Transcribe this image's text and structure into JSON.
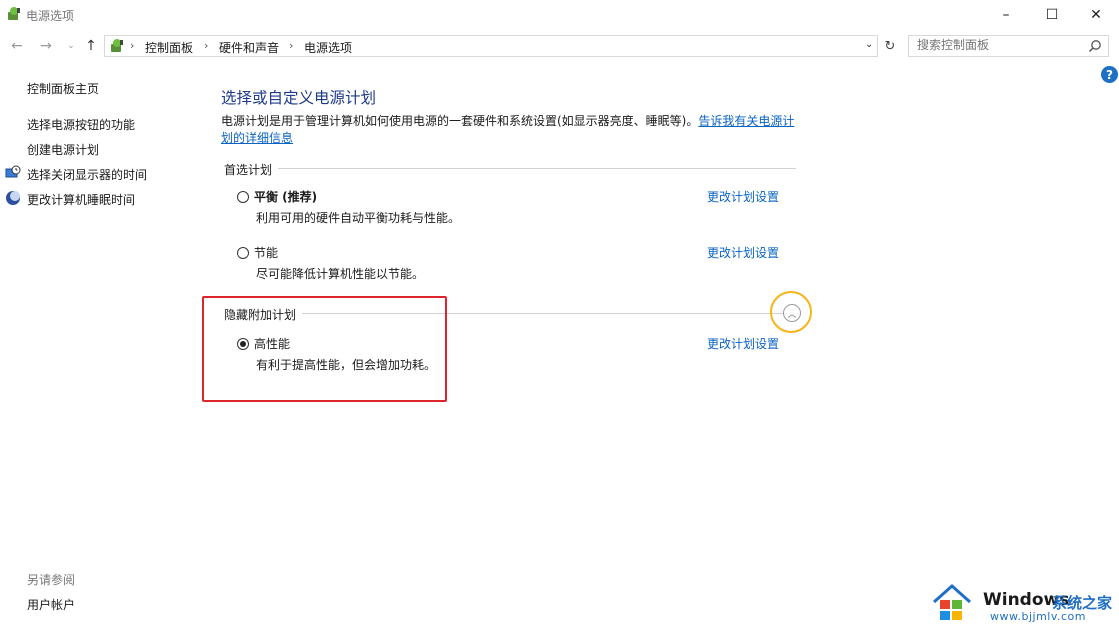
{
  "window": {
    "title": "电源选项"
  },
  "address": {
    "crumbs": [
      "控制面板",
      "硬件和声音",
      "电源选项"
    ]
  },
  "search": {
    "placeholder": "搜索控制面板"
  },
  "sidebar": {
    "home": "控制面板主页",
    "items": [
      {
        "label": "选择电源按钮的功能",
        "icon": ""
      },
      {
        "label": "创建电源计划",
        "icon": ""
      },
      {
        "label": "选择关闭显示器的时间",
        "icon": "monitor-clock-icon"
      },
      {
        "label": "更改计算机睡眠时间",
        "icon": "moon-globe-icon"
      }
    ],
    "see_also_title": "另请参阅",
    "see_also_items": [
      "用户帐户"
    ]
  },
  "main": {
    "title": "选择或自定义电源计划",
    "description": "电源计划是用于管理计算机如何使用电源的一套硬件和系统设置(如显示器亮度、睡眠等)。",
    "description_link": "告诉我有关电源计划的详细信息",
    "preferred_label": "首选计划",
    "hidden_label": "隐藏附加计划",
    "change_link": "更改计划设置",
    "plans": [
      {
        "name": "平衡 (推荐)",
        "desc": "利用可用的硬件自动平衡功耗与性能。",
        "selected": false
      },
      {
        "name": "节能",
        "desc": "尽可能降低计算机性能以节能。",
        "selected": false
      },
      {
        "name": "高性能",
        "desc": "有利于提高性能，但会增加功耗。",
        "selected": true
      }
    ]
  },
  "watermark": {
    "brand": "Windows",
    "brand_cn": "系统之家",
    "url": "www.bjjmlv.com"
  },
  "colors": {
    "link": "#0b63c4",
    "title": "#1e3a8a",
    "highlight_box": "#e0242c",
    "highlight_ring": "#f5b516"
  }
}
